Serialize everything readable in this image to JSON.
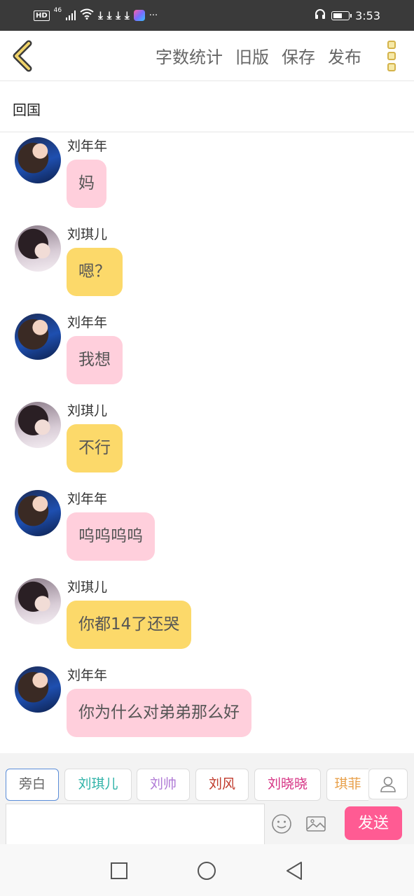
{
  "status_bar": {
    "time": "3:53",
    "network": "46",
    "hd": "HD",
    "more": "···"
  },
  "toolbar": {
    "word_count": "字数统计",
    "old_version": "旧版",
    "save": "保存",
    "publish": "发布"
  },
  "title": "回国",
  "messages": [
    {
      "sender": "刘年年",
      "text": "妈",
      "avatar": "liu-niannian",
      "bubble_color": "#ffcfdc"
    },
    {
      "sender": "刘琪儿",
      "text": "嗯？",
      "avatar": "liu-qier",
      "bubble_color": "#fcd96a"
    },
    {
      "sender": "刘年年",
      "text": "我想",
      "avatar": "liu-niannian",
      "bubble_color": "#ffcfdc"
    },
    {
      "sender": "刘琪儿",
      "text": "不行",
      "avatar": "liu-qier",
      "bubble_color": "#fcd96a"
    },
    {
      "sender": "刘年年",
      "text": "呜呜呜呜",
      "avatar": "liu-niannian",
      "bubble_color": "#ffcfdc"
    },
    {
      "sender": "刘琪儿",
      "text": "你都14了还哭",
      "avatar": "liu-qier",
      "bubble_color": "#fcd96a"
    },
    {
      "sender": "刘年年",
      "text": "你为什么对弟弟那么好",
      "avatar": "liu-niannian",
      "bubble_color": "#ffcfdc"
    }
  ],
  "roles": [
    {
      "label": "旁白",
      "color": "#666666"
    },
    {
      "label": "刘琪儿",
      "color": "#2fb3a8"
    },
    {
      "label": "刘帅",
      "color": "#b07ad6"
    },
    {
      "label": "刘风",
      "color": "#c0392b"
    },
    {
      "label": "刘晓晓",
      "color": "#d63384"
    },
    {
      "label": "琪菲",
      "color": "#e8a04a"
    }
  ],
  "input": {
    "placeholder": "",
    "send": "发送"
  },
  "colors": {
    "accent_pink": "#ff5b93",
    "bubble_pink": "#ffcfdc",
    "bubble_yellow": "#fcd96a",
    "back_arrow": "#d4b34a"
  }
}
